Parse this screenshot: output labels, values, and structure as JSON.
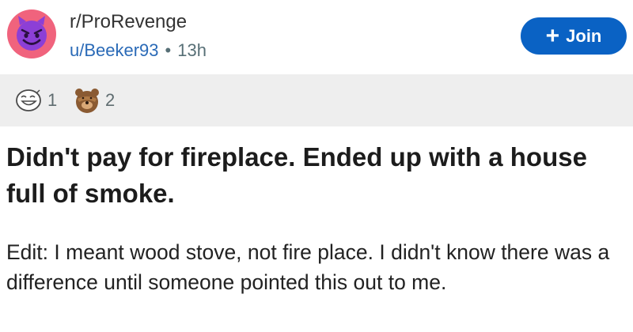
{
  "post": {
    "subreddit": "r/ProRevenge",
    "author": "u/Beeker93",
    "separator": "•",
    "age": "13h",
    "join_label": "Join",
    "join_icon": "+",
    "awards": [
      {
        "icon": "laughing-face-award-icon",
        "count": "1"
      },
      {
        "icon": "bear-facepalm-award-icon",
        "count": "2"
      }
    ],
    "title": "Didn't pay for fireplace. Ended up with a house full of smoke.",
    "body": "Edit: I meant wood stove, not fire place. I didn't know there was a difference until someone pointed this out to me."
  },
  "colors": {
    "accent": "#0a62c4",
    "avatar_bg": "#f0637d",
    "avatar_face": "#8c3fd6",
    "username": "#2a6ab7",
    "award_bar_bg": "#eeeeee"
  }
}
